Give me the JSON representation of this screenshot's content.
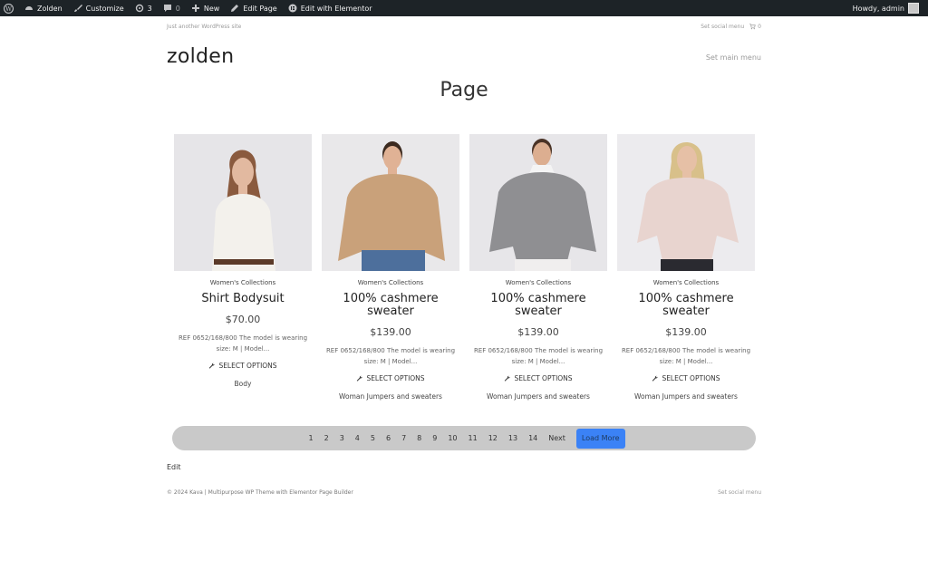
{
  "adminbar": {
    "site_name": "Zolden",
    "customize": "Customize",
    "updates_count": "3",
    "comments_count": "0",
    "new": "New",
    "edit_page": "Edit Page",
    "edit_elementor": "Edit with Elementor",
    "howdy": "Howdy, admin"
  },
  "header": {
    "tagline": "Just another WordPress site",
    "social_menu": "Set social menu",
    "cart_count": "0",
    "site_title": "zolden",
    "main_menu": "Set main menu"
  },
  "page_title": "Page",
  "products": [
    {
      "category": "Women's Collections",
      "title": "Shirt Bodysuit",
      "price": "$70.00",
      "excerpt": "REF 0652/168/800 The model is wearing size: M | Model...",
      "action": "SELECT OPTIONS",
      "tag": "Body",
      "garment_color": "#f3f1ec"
    },
    {
      "category": "Women's Collections",
      "title": "100% cashmere sweater",
      "price": "$139.00",
      "excerpt": "REF 0652/168/800 The model is wearing size: M | Model...",
      "action": "SELECT OPTIONS",
      "tag": "Woman Jumpers and sweaters",
      "garment_color": "#c9a17a"
    },
    {
      "category": "Women's Collections",
      "title": "100% cashmere sweater",
      "price": "$139.00",
      "excerpt": "REF 0652/168/800 The model is wearing size: M | Model...",
      "action": "SELECT OPTIONS",
      "tag": "Woman Jumpers and sweaters",
      "garment_color": "#8f8f92"
    },
    {
      "category": "Women's Collections",
      "title": "100% cashmere sweater",
      "price": "$139.00",
      "excerpt": "REF 0652/168/800 The model is wearing size: M | Model...",
      "action": "SELECT OPTIONS",
      "tag": "Woman Jumpers and sweaters",
      "garment_color": "#e8d4cf"
    }
  ],
  "pagination": {
    "pages": [
      "1",
      "2",
      "3",
      "4",
      "5",
      "6",
      "7",
      "8",
      "9",
      "10",
      "11",
      "12",
      "13",
      "14"
    ],
    "next": "Next",
    "load_more": "Load More"
  },
  "edit_link": "Edit",
  "footer": {
    "copyright": "© 2024 Kava | Multipurpose WP Theme with Elementor Page Builder",
    "social_menu": "Set social menu"
  },
  "colors": {
    "adminbar_bg": "#1d2327",
    "load_more_bg": "#3b82f6",
    "pager_bg": "#c9c9c9"
  }
}
